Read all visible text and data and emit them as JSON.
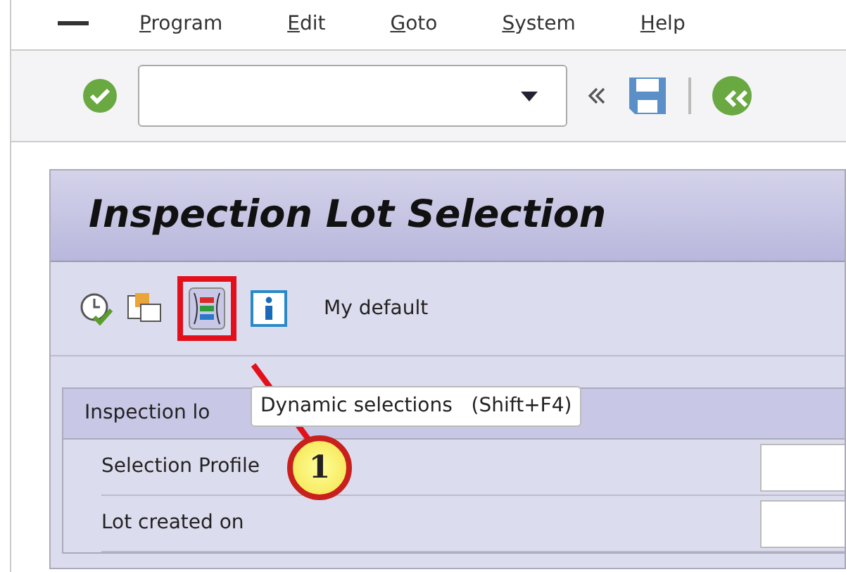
{
  "menu": [
    "Program",
    "Edit",
    "Goto",
    "System",
    "Help"
  ],
  "title": "Inspection Lot Selection",
  "app_toolbar": {
    "variant_label": "My default"
  },
  "tooltip": {
    "text": "Dynamic selections",
    "shortcut": "(Shift+F4)"
  },
  "callout": {
    "number": "1"
  },
  "group": {
    "title": "Inspection lo",
    "rows": [
      {
        "label": "Selection Profile"
      },
      {
        "label": "Lot created on"
      }
    ]
  }
}
